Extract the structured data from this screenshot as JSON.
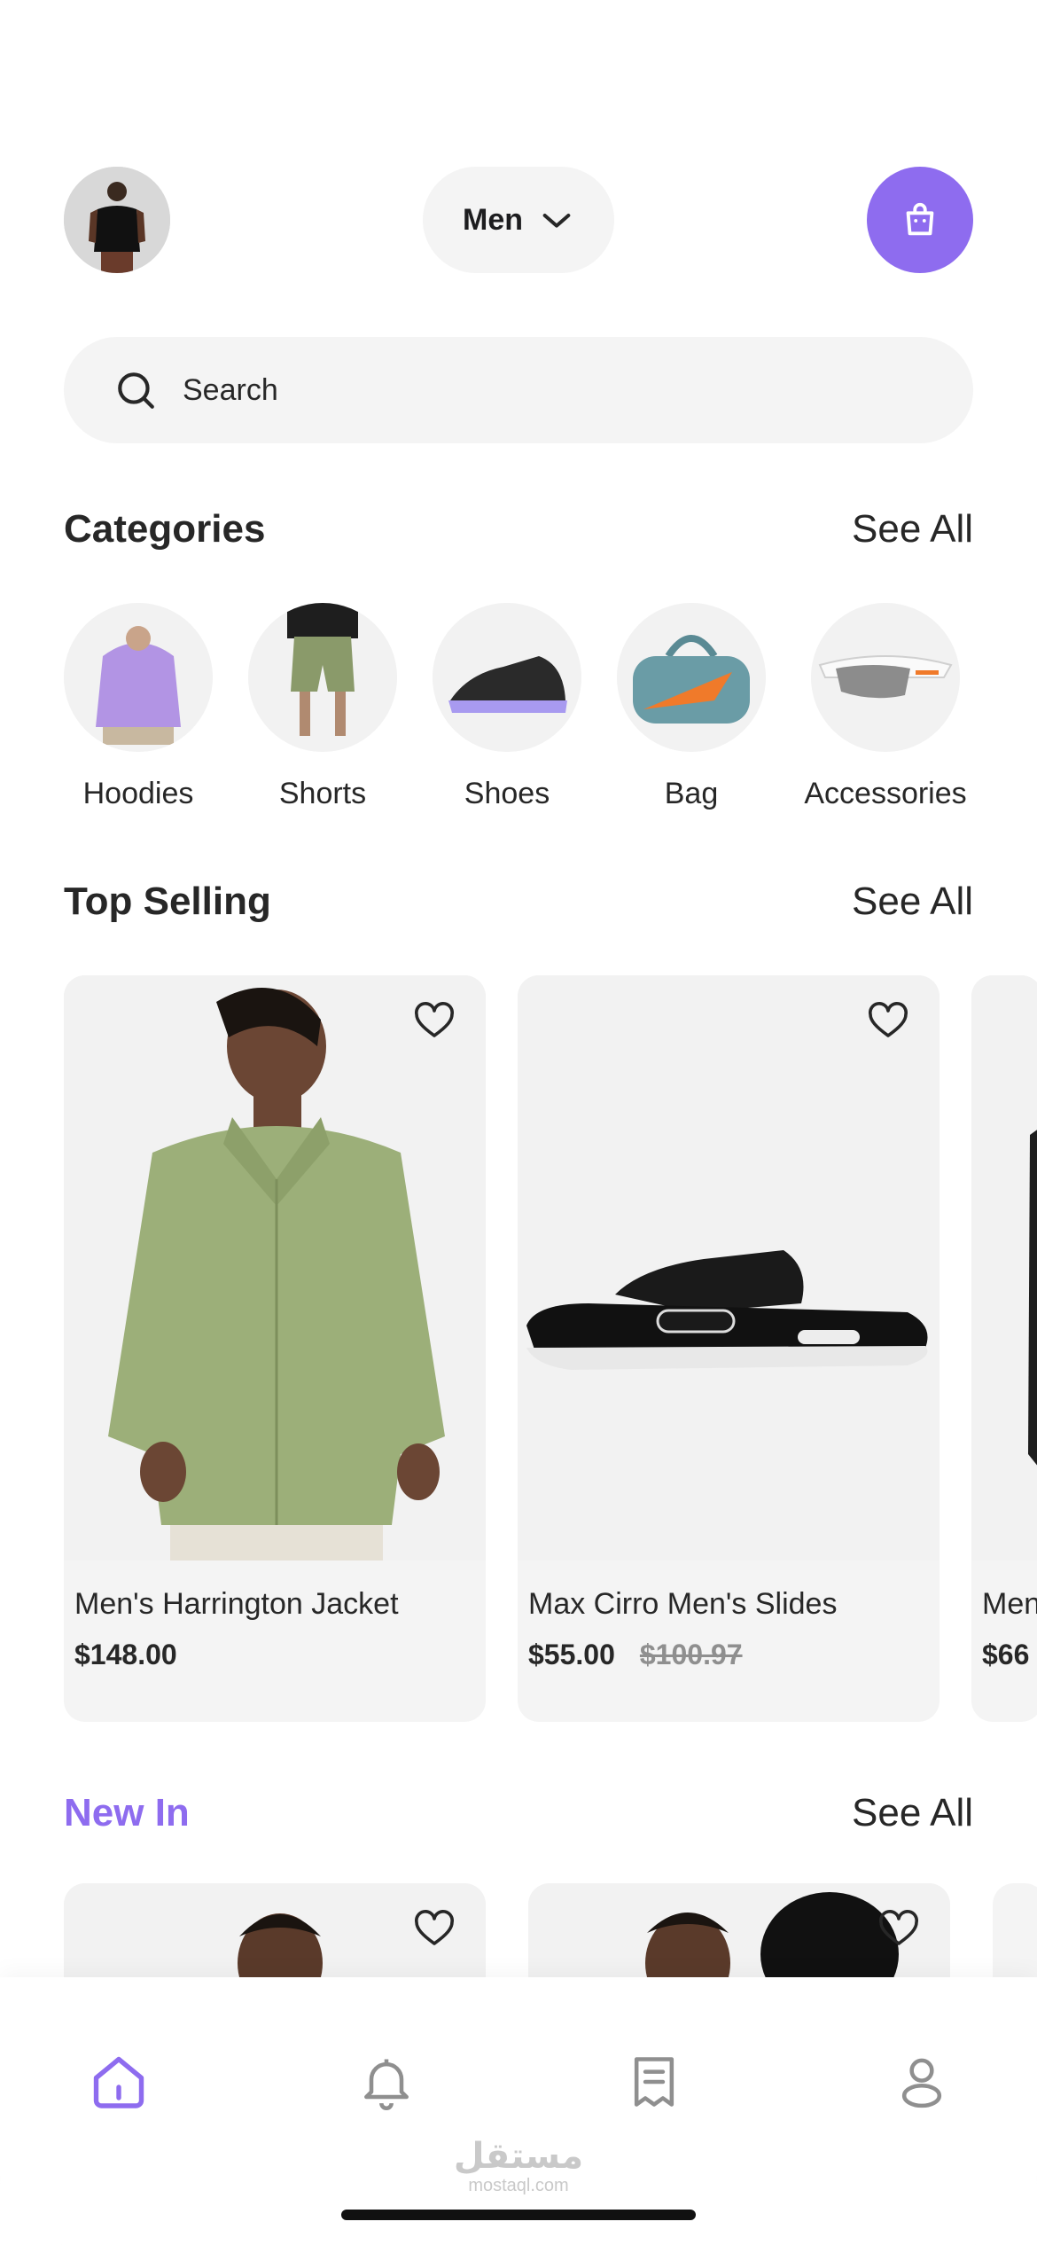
{
  "header": {
    "gender_label": "Men",
    "avatar_alt": "avatar"
  },
  "search": {
    "placeholder": "Search"
  },
  "categories": {
    "title": "Categories",
    "see_all": "See All",
    "items": [
      {
        "label": "Hoodies"
      },
      {
        "label": "Shorts"
      },
      {
        "label": "Shoes"
      },
      {
        "label": "Bag"
      },
      {
        "label": "Accessories"
      }
    ]
  },
  "top_selling": {
    "title": "Top Selling",
    "see_all": "See All",
    "products": [
      {
        "name": "Men's Harrington Jacket",
        "price": "$148.00",
        "old_price": ""
      },
      {
        "name": "Max Cirro Men's Slides",
        "price": "$55.00",
        "old_price": "$100.97"
      },
      {
        "name": "Men",
        "price": "$66",
        "old_price": ""
      }
    ]
  },
  "new_in": {
    "title": "New In",
    "see_all": "See All"
  },
  "watermark": {
    "arabic": "مستقل",
    "latin": "mostaql.com"
  },
  "colors": {
    "accent": "#8e6cef",
    "surface": "#f4f4f4",
    "text": "#272727"
  }
}
